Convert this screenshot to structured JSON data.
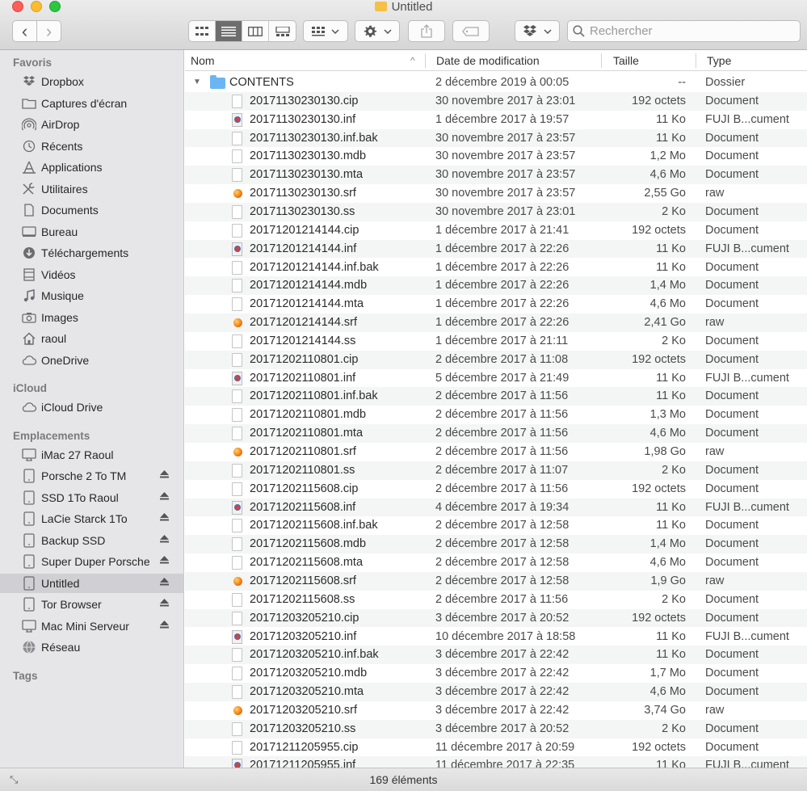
{
  "window": {
    "title": "Untitled"
  },
  "toolbar": {
    "back_glyph": "‹",
    "forward_glyph": "›",
    "search_placeholder": "Rechercher"
  },
  "sidebar": {
    "favoris_header": "Favoris",
    "favoris": [
      {
        "label": "Dropbox",
        "icon": "dropbox-icon"
      },
      {
        "label": "Captures d'écran",
        "icon": "folder-icon"
      },
      {
        "label": "AirDrop",
        "icon": "airdrop-icon"
      },
      {
        "label": "Récents",
        "icon": "clock-icon"
      },
      {
        "label": "Applications",
        "icon": "applications-icon"
      },
      {
        "label": "Utilitaires",
        "icon": "tools-icon"
      },
      {
        "label": "Documents",
        "icon": "documents-icon"
      },
      {
        "label": "Bureau",
        "icon": "desktop-icon"
      },
      {
        "label": "Téléchargements",
        "icon": "download-icon"
      },
      {
        "label": "Vidéos",
        "icon": "film-icon"
      },
      {
        "label": "Musique",
        "icon": "music-icon"
      },
      {
        "label": "Images",
        "icon": "camera-icon"
      },
      {
        "label": "raoul",
        "icon": "home-icon"
      },
      {
        "label": "OneDrive",
        "icon": "cloud-icon"
      }
    ],
    "icloud_header": "iCloud",
    "icloud": [
      {
        "label": "iCloud Drive",
        "icon": "cloud-icon"
      }
    ],
    "emplacements_header": "Emplacements",
    "emplacements": [
      {
        "label": "iMac 27 Raoul",
        "icon": "imac-icon",
        "eject": false
      },
      {
        "label": "Porsche 2 To TM",
        "icon": "disk-icon",
        "eject": true
      },
      {
        "label": "SSD 1To Raoul",
        "icon": "disk-icon",
        "eject": true
      },
      {
        "label": "LaCie Starck 1To",
        "icon": "disk-icon",
        "eject": true
      },
      {
        "label": "Backup SSD",
        "icon": "disk-icon",
        "eject": true
      },
      {
        "label": "Super Duper Porsche",
        "icon": "disk-icon",
        "eject": true
      },
      {
        "label": "Untitled",
        "icon": "disk-icon",
        "eject": true
      },
      {
        "label": "Tor Browser",
        "icon": "disk-icon",
        "eject": true
      },
      {
        "label": "Mac Mini Serveur",
        "icon": "imac-icon",
        "eject": true
      },
      {
        "label": "Réseau",
        "icon": "globe-icon",
        "eject": false
      }
    ],
    "tags_header": "Tags"
  },
  "columns": {
    "name": "Nom",
    "date": "Date de modification",
    "size": "Taille",
    "type": "Type"
  },
  "folder": {
    "name": "CONTENTS",
    "date": "2 décembre 2019 à 00:05",
    "size": "--",
    "type": "Dossier"
  },
  "files": [
    {
      "name": "20171130230130.cip",
      "date": "30 novembre 2017 à 23:01",
      "size": "192 octets",
      "type": "Document",
      "kind": "doc"
    },
    {
      "name": "20171130230130.inf",
      "date": "1 décembre 2017 à 19:57",
      "size": "11 Ko",
      "type": "FUJI B...cument",
      "kind": "fuji"
    },
    {
      "name": "20171130230130.inf.bak",
      "date": "30 novembre 2017 à 23:57",
      "size": "11 Ko",
      "type": "Document",
      "kind": "doc"
    },
    {
      "name": "20171130230130.mdb",
      "date": "30 novembre 2017 à 23:57",
      "size": "1,2 Mo",
      "type": "Document",
      "kind": "doc"
    },
    {
      "name": "20171130230130.mta",
      "date": "30 novembre 2017 à 23:57",
      "size": "4,6 Mo",
      "type": "Document",
      "kind": "doc"
    },
    {
      "name": "20171130230130.srf",
      "date": "30 novembre 2017 à 23:57",
      "size": "2,55 Go",
      "type": "raw",
      "kind": "raw"
    },
    {
      "name": "20171130230130.ss",
      "date": "30 novembre 2017 à 23:01",
      "size": "2 Ko",
      "type": "Document",
      "kind": "doc"
    },
    {
      "name": "20171201214144.cip",
      "date": "1 décembre 2017 à 21:41",
      "size": "192 octets",
      "type": "Document",
      "kind": "doc"
    },
    {
      "name": "20171201214144.inf",
      "date": "1 décembre 2017 à 22:26",
      "size": "11 Ko",
      "type": "FUJI B...cument",
      "kind": "fuji"
    },
    {
      "name": "20171201214144.inf.bak",
      "date": "1 décembre 2017 à 22:26",
      "size": "11 Ko",
      "type": "Document",
      "kind": "doc"
    },
    {
      "name": "20171201214144.mdb",
      "date": "1 décembre 2017 à 22:26",
      "size": "1,4 Mo",
      "type": "Document",
      "kind": "doc"
    },
    {
      "name": "20171201214144.mta",
      "date": "1 décembre 2017 à 22:26",
      "size": "4,6 Mo",
      "type": "Document",
      "kind": "doc"
    },
    {
      "name": "20171201214144.srf",
      "date": "1 décembre 2017 à 22:26",
      "size": "2,41 Go",
      "type": "raw",
      "kind": "raw"
    },
    {
      "name": "20171201214144.ss",
      "date": "1 décembre 2017 à 21:11",
      "size": "2 Ko",
      "type": "Document",
      "kind": "doc"
    },
    {
      "name": "20171202110801.cip",
      "date": "2 décembre 2017 à 11:08",
      "size": "192 octets",
      "type": "Document",
      "kind": "doc"
    },
    {
      "name": "20171202110801.inf",
      "date": "5 décembre 2017 à 21:49",
      "size": "11 Ko",
      "type": "FUJI B...cument",
      "kind": "fuji"
    },
    {
      "name": "20171202110801.inf.bak",
      "date": "2 décembre 2017 à 11:56",
      "size": "11 Ko",
      "type": "Document",
      "kind": "doc"
    },
    {
      "name": "20171202110801.mdb",
      "date": "2 décembre 2017 à 11:56",
      "size": "1,3 Mo",
      "type": "Document",
      "kind": "doc"
    },
    {
      "name": "20171202110801.mta",
      "date": "2 décembre 2017 à 11:56",
      "size": "4,6 Mo",
      "type": "Document",
      "kind": "doc"
    },
    {
      "name": "20171202110801.srf",
      "date": "2 décembre 2017 à 11:56",
      "size": "1,98 Go",
      "type": "raw",
      "kind": "raw"
    },
    {
      "name": "20171202110801.ss",
      "date": "2 décembre 2017 à 11:07",
      "size": "2 Ko",
      "type": "Document",
      "kind": "doc"
    },
    {
      "name": "20171202115608.cip",
      "date": "2 décembre 2017 à 11:56",
      "size": "192 octets",
      "type": "Document",
      "kind": "doc"
    },
    {
      "name": "20171202115608.inf",
      "date": "4 décembre 2017 à 19:34",
      "size": "11 Ko",
      "type": "FUJI B...cument",
      "kind": "fuji"
    },
    {
      "name": "20171202115608.inf.bak",
      "date": "2 décembre 2017 à 12:58",
      "size": "11 Ko",
      "type": "Document",
      "kind": "doc"
    },
    {
      "name": "20171202115608.mdb",
      "date": "2 décembre 2017 à 12:58",
      "size": "1,4 Mo",
      "type": "Document",
      "kind": "doc"
    },
    {
      "name": "20171202115608.mta",
      "date": "2 décembre 2017 à 12:58",
      "size": "4,6 Mo",
      "type": "Document",
      "kind": "doc"
    },
    {
      "name": "20171202115608.srf",
      "date": "2 décembre 2017 à 12:58",
      "size": "1,9 Go",
      "type": "raw",
      "kind": "raw"
    },
    {
      "name": "20171202115608.ss",
      "date": "2 décembre 2017 à 11:56",
      "size": "2 Ko",
      "type": "Document",
      "kind": "doc"
    },
    {
      "name": "20171203205210.cip",
      "date": "3 décembre 2017 à 20:52",
      "size": "192 octets",
      "type": "Document",
      "kind": "doc"
    },
    {
      "name": "20171203205210.inf",
      "date": "10 décembre 2017 à 18:58",
      "size": "11 Ko",
      "type": "FUJI B...cument",
      "kind": "fuji"
    },
    {
      "name": "20171203205210.inf.bak",
      "date": "3 décembre 2017 à 22:42",
      "size": "11 Ko",
      "type": "Document",
      "kind": "doc"
    },
    {
      "name": "20171203205210.mdb",
      "date": "3 décembre 2017 à 22:42",
      "size": "1,7 Mo",
      "type": "Document",
      "kind": "doc"
    },
    {
      "name": "20171203205210.mta",
      "date": "3 décembre 2017 à 22:42",
      "size": "4,6 Mo",
      "type": "Document",
      "kind": "doc"
    },
    {
      "name": "20171203205210.srf",
      "date": "3 décembre 2017 à 22:42",
      "size": "3,74 Go",
      "type": "raw",
      "kind": "raw"
    },
    {
      "name": "20171203205210.ss",
      "date": "3 décembre 2017 à 20:52",
      "size": "2 Ko",
      "type": "Document",
      "kind": "doc"
    },
    {
      "name": "20171211205955.cip",
      "date": "11 décembre 2017 à 20:59",
      "size": "192 octets",
      "type": "Document",
      "kind": "doc"
    },
    {
      "name": "20171211205955.inf",
      "date": "11 décembre 2017 à 22:35",
      "size": "11 Ko",
      "type": "FUJI B...cument",
      "kind": "fuji"
    }
  ],
  "status": {
    "item_count": "169 éléments"
  }
}
